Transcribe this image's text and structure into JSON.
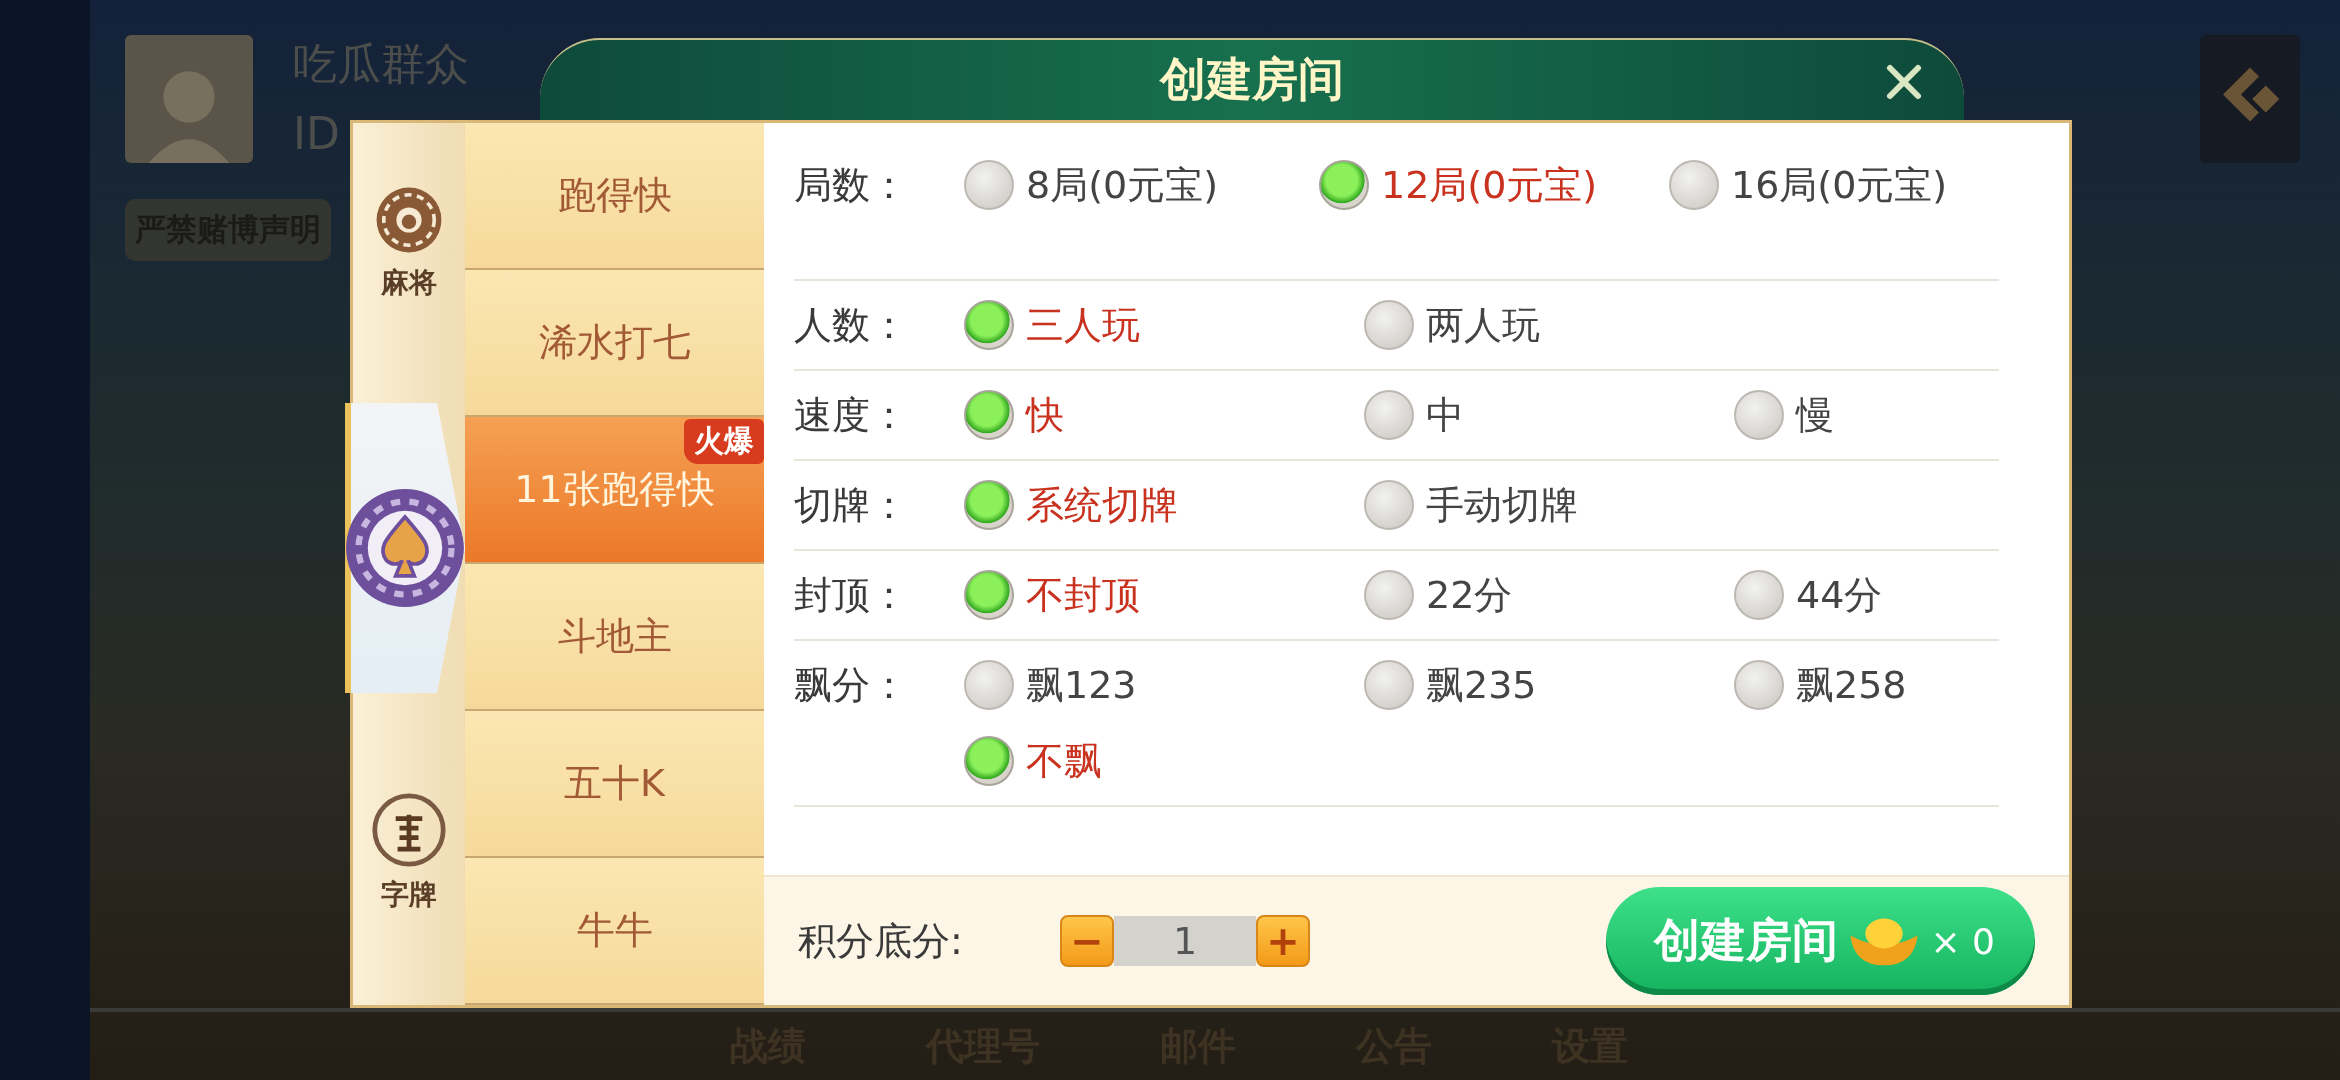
{
  "background": {
    "player_name": "吃瓜群众",
    "player_id": "ID",
    "notice": "严禁赌博声明",
    "nav": [
      "战绩",
      "代理号",
      "邮件",
      "公告",
      "设置"
    ]
  },
  "dialog": {
    "title": "创建房间"
  },
  "categories": [
    {
      "kind": "mahjong",
      "label": "麻将",
      "selected": false
    },
    {
      "kind": "poker",
      "selected": true
    },
    {
      "kind": "zipai",
      "label": "字牌",
      "selected": false
    }
  ],
  "games": [
    {
      "label": "跑得快",
      "selected": false
    },
    {
      "label": "浠水打七",
      "selected": false
    },
    {
      "label": "11张跑得快",
      "selected": true,
      "badge": "火爆"
    },
    {
      "label": "斗地主",
      "selected": false
    },
    {
      "label": "五十K",
      "selected": false
    },
    {
      "label": "牛牛",
      "selected": false
    }
  ],
  "options": [
    {
      "label": "局数：",
      "kind": "wide",
      "choices": [
        {
          "text": "8局(0元宝)",
          "selected": false
        },
        {
          "text": "12局(0元宝)",
          "selected": true
        },
        {
          "text": "16局(0元宝)",
          "selected": false
        }
      ]
    },
    {
      "label": "人数：",
      "kind": "normal",
      "choices": [
        {
          "text": "三人玩",
          "selected": true
        },
        {
          "text": "两人玩",
          "selected": false
        }
      ]
    },
    {
      "label": "速度：",
      "kind": "normal",
      "choices": [
        {
          "text": "快",
          "selected": true
        },
        {
          "text": "中",
          "selected": false
        },
        {
          "text": "慢",
          "selected": false
        }
      ]
    },
    {
      "label": "切牌：",
      "kind": "normal",
      "choices": [
        {
          "text": "系统切牌",
          "selected": true
        },
        {
          "text": "手动切牌",
          "selected": false
        }
      ]
    },
    {
      "label": "封顶：",
      "kind": "normal",
      "choices": [
        {
          "text": "不封顶",
          "selected": true
        },
        {
          "text": "22分",
          "selected": false
        },
        {
          "text": "44分",
          "selected": false
        }
      ]
    },
    {
      "label": "飘分：",
      "kind": "normal",
      "choices": [
        {
          "text": "飘123",
          "selected": false
        },
        {
          "text": "飘235",
          "selected": false
        },
        {
          "text": "飘258",
          "selected": false
        },
        {
          "text": "不飘",
          "selected": true
        }
      ]
    }
  ],
  "score": {
    "label": "积分底分:",
    "minus": "−",
    "value": "1",
    "plus": "+"
  },
  "create_button": {
    "label": "创建房间",
    "count": "× 0"
  }
}
